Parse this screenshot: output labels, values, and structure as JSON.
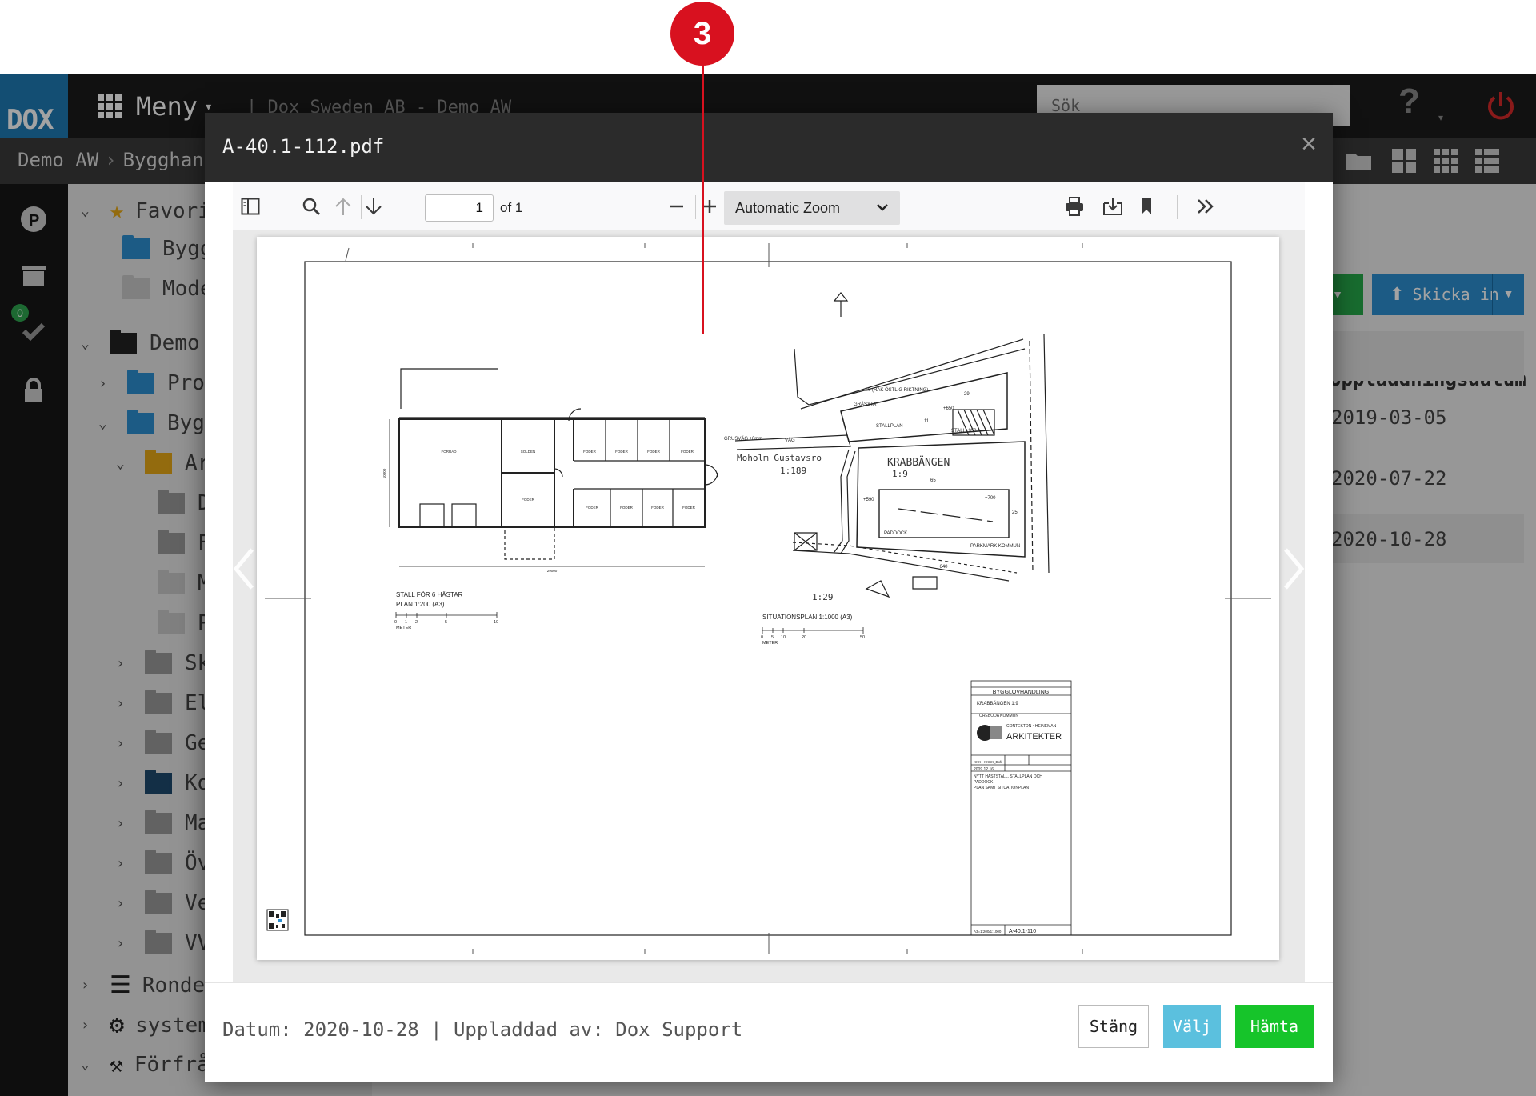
{
  "app": {
    "logo": "DOX",
    "menu_label": "Meny",
    "company": "| Dox Sweden AB - Demo AW",
    "search_placeholder": "Sök",
    "help": "?"
  },
  "breadcrumb": [
    "Demo AW",
    "Bygghandlingar"
  ],
  "rail_badge": "0",
  "tree": [
    {
      "label": "Favoriter"
    },
    {
      "label": "Bygghandlingar"
    },
    {
      "label": "Modeller"
    },
    {
      "label": "Demo AW"
    },
    {
      "label": "Projekt"
    },
    {
      "label": "Bygghandlingar"
    },
    {
      "label": "Arkitekt"
    },
    {
      "label": "D"
    },
    {
      "label": "F"
    },
    {
      "label": "M"
    },
    {
      "label": "P"
    },
    {
      "label": "Sk"
    },
    {
      "label": "El"
    },
    {
      "label": "Ge"
    },
    {
      "label": "Ko"
    },
    {
      "label": "Ma"
    },
    {
      "label": "Öv"
    },
    {
      "label": "Ve"
    },
    {
      "label": "VV"
    },
    {
      "label": "Ronder"
    },
    {
      "label": "system"
    },
    {
      "label": "Förfrågan"
    }
  ],
  "right_pane": {
    "send_label": "Skicka in",
    "column_header": "Uppladdningsdatum",
    "dates": [
      "2019-03-05",
      "2020-07-22",
      "2020-10-28"
    ]
  },
  "modal": {
    "title": "A-40.1-112.pdf",
    "close": "×",
    "footer_info": "Datum: 2020-10-28 | Uppladdad av: Dox Support",
    "buttons": {
      "close": "Stäng",
      "select": "Välj",
      "download": "Hämta"
    }
  },
  "pdf": {
    "page_number": "1",
    "page_count": "of 1",
    "zoom": "Automatic Zoom"
  },
  "drawing_text": {
    "stall_title": "STALL FÖR 6 HÄSTAR",
    "stall_scale": "PLAN 1:200 (A3)",
    "stall_scalebar": [
      "0",
      "1",
      "2",
      "5",
      "10"
    ],
    "meter": "METER",
    "dim_width": "29000",
    "dim_height": "10000",
    "rooms": [
      "FÖRRÅD",
      "SOLDEN",
      "FODER",
      "FODER",
      "FODER",
      "FODER",
      "FODER",
      "FODER",
      "FODER",
      "FODER",
      "FODER"
    ],
    "site_title": "SITUATIONSPLAN 1:1000 (A3)",
    "site_scalebar": [
      "0",
      "5",
      "10",
      "20",
      "50"
    ],
    "site_labels": {
      "road_direction": "S0 (RAK ÖSTLIG RIKTNING)",
      "grasyta": "GRÄSYTA",
      "stallplan": "STALLPLAN",
      "stall": "STALL",
      "grusvag": "GRUSVÄG ±0mm",
      "vag": "VÄG",
      "moholm": "Moholm Gustavsro",
      "moholm_no": "1:189",
      "krabbangen": "KRABBÄNGEN",
      "krabbangen_no": "1:9",
      "paddock": "PADDOCK",
      "parkmark": "PARKMARK KOMMUN",
      "lot_129": "1:29",
      "h650": "+650",
      "h950": "+950",
      "h590": "+590",
      "h700": "+700",
      "h640": "+640",
      "d29": "29",
      "d11": "11",
      "d65": "65",
      "d25": "25"
    },
    "title_block": {
      "handling": "BYGGLOVHANDLING",
      "property": "KRABBÄNGEN 1:9",
      "municipality": "TÖREBODA KOMMUN",
      "firm_small": "CONTEKTON • HEINEMAN",
      "firm": "ARKITEKTER",
      "date": "2009.12.16",
      "desc1": "NYTT HÄSTSTALL, STALLPLAN OCH",
      "desc2": "PADDOCK",
      "desc3": "PLAN SAMT SITUATIONPLAN",
      "scale": "A3=1:200/1:1000",
      "drawing_no": "A-40.1-110",
      "file": "XXX - XXXX_Dxfr"
    }
  },
  "callout": "3",
  "colors": {
    "brand_blue": "#1f7bb5",
    "callout_red": "#d8111f",
    "download_green": "#16c42a",
    "select_blue": "#5bc0de"
  }
}
